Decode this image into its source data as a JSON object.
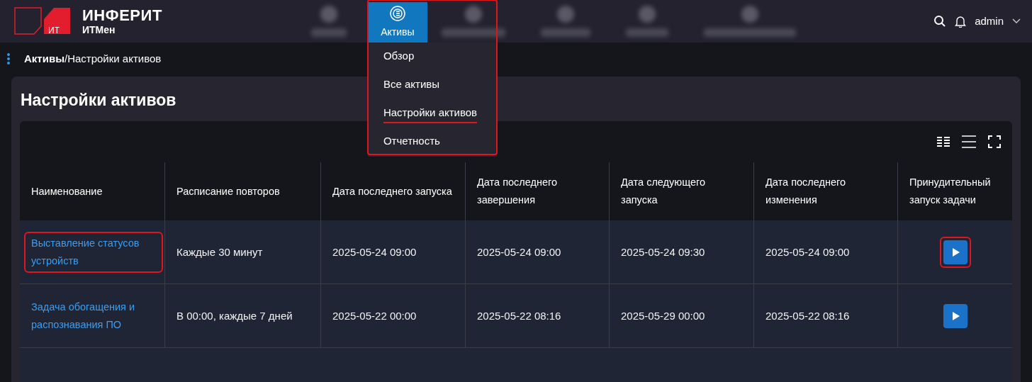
{
  "brand": {
    "name": "ИНФЕРИТ",
    "product": "ИТМен",
    "badge": "ИТ"
  },
  "nav": {
    "active_tab": {
      "label": "Активы",
      "selected": true
    },
    "menu": [
      {
        "label": "Обзор",
        "highlighted": false
      },
      {
        "label": "Все активы",
        "highlighted": false
      },
      {
        "label": "Настройки активов",
        "highlighted": true
      },
      {
        "label": "Отчетность",
        "highlighted": false
      }
    ],
    "highlighted": true
  },
  "user": {
    "name": "admin"
  },
  "breadcrumb": {
    "parent": "Активы",
    "separator": "/",
    "current": "Настройки активов"
  },
  "page_title": "Настройки активов",
  "table": {
    "columns": [
      "Наименование",
      "Расписание повторов",
      "Дата последнего запуска",
      "Дата последнего завершения",
      "Дата следующего запуска",
      "Дата последнего изменения",
      "Принудительный запуск задачи"
    ],
    "rows": [
      {
        "name": "Выставление статусов устройств",
        "schedule": "Каждые 30 минут",
        "last_run": "2025-05-24 09:00",
        "last_finish": "2025-05-24 09:00",
        "next_run": "2025-05-24 09:30",
        "last_change": "2025-05-24 09:00",
        "highlighted": true
      },
      {
        "name": "Задача обогащения и распознавания ПО",
        "schedule": "В 00:00, каждые 7 дней",
        "last_run": "2025-05-22 00:00",
        "last_finish": "2025-05-22 08:16",
        "next_run": "2025-05-29 00:00",
        "last_change": "2025-05-22 08:16",
        "highlighted": false
      }
    ]
  }
}
